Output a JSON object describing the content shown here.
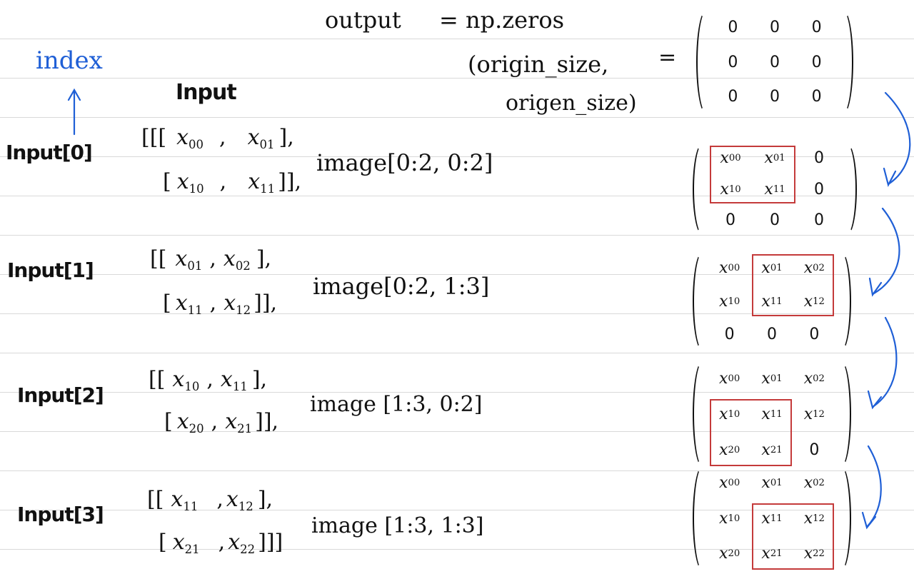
{
  "header": {
    "output_label": "output",
    "eq": "= np.zeros",
    "args_line1": "(origin_size,",
    "args_line2": "origen_size)",
    "equals": "="
  },
  "index_label": "index",
  "input_heading": "Input",
  "rows": [
    {
      "label": "Input[0]",
      "line1": [
        "[[[",
        "x00",
        ",",
        "x01",
        "],"
      ],
      "line2": [
        "[",
        "x10",
        ",",
        "x11",
        "]],"
      ],
      "slice": "image[0:2, 0:2]",
      "matrix": [
        [
          "x00",
          "x01",
          "0"
        ],
        [
          "x10",
          "x11",
          "0"
        ],
        [
          "0",
          "0",
          "0"
        ]
      ],
      "highlight": {
        "r0": 0,
        "c0": 0,
        "r1": 1,
        "c1": 1
      }
    },
    {
      "label": "Input[1]",
      "line1": [
        "[[",
        "x01",
        ",",
        "x02",
        "],"
      ],
      "line2": [
        "[",
        "x11",
        ",",
        "x12",
        "]],"
      ],
      "slice": "image[0:2, 1:3]",
      "matrix": [
        [
          "x00",
          "x01",
          "x02"
        ],
        [
          "x10",
          "x11",
          "x12"
        ],
        [
          "0",
          "0",
          "0"
        ]
      ],
      "highlight": {
        "r0": 0,
        "c0": 1,
        "r1": 1,
        "c1": 2
      }
    },
    {
      "label": "Input[2]",
      "line1": [
        "[[",
        "x10",
        ",",
        "x11",
        "],"
      ],
      "line2": [
        "[",
        "x20",
        ",",
        "x21",
        "]],"
      ],
      "slice": "image [1:3, 0:2]",
      "matrix": [
        [
          "x00",
          "x01",
          "x02"
        ],
        [
          "x10",
          "x11",
          "x12"
        ],
        [
          "x20",
          "x21",
          "0"
        ]
      ],
      "highlight": {
        "r0": 1,
        "c0": 0,
        "r1": 2,
        "c1": 1
      }
    },
    {
      "label": "Input[3]",
      "line1": [
        "[[",
        "x11",
        ",",
        "x12",
        "],"
      ],
      "line2": [
        "[",
        "x21",
        ",",
        "x22",
        "]]]"
      ],
      "slice": "image [1:3, 1:3]",
      "matrix": [
        [
          "x00",
          "x01",
          "x02"
        ],
        [
          "x10",
          "x11",
          "x12"
        ],
        [
          "x20",
          "x21",
          "x22"
        ]
      ],
      "highlight": {
        "r0": 1,
        "c0": 1,
        "r1": 2,
        "c1": 2
      }
    }
  ],
  "zero_matrix": [
    [
      "0",
      "0",
      "0"
    ],
    [
      "0",
      "0",
      "0"
    ],
    [
      "0",
      "0",
      "0"
    ]
  ],
  "colors": {
    "ink": "#111111",
    "blue": "#1f5fd6",
    "highlight": "#c43a3a",
    "rule": "#d9d9d9"
  }
}
